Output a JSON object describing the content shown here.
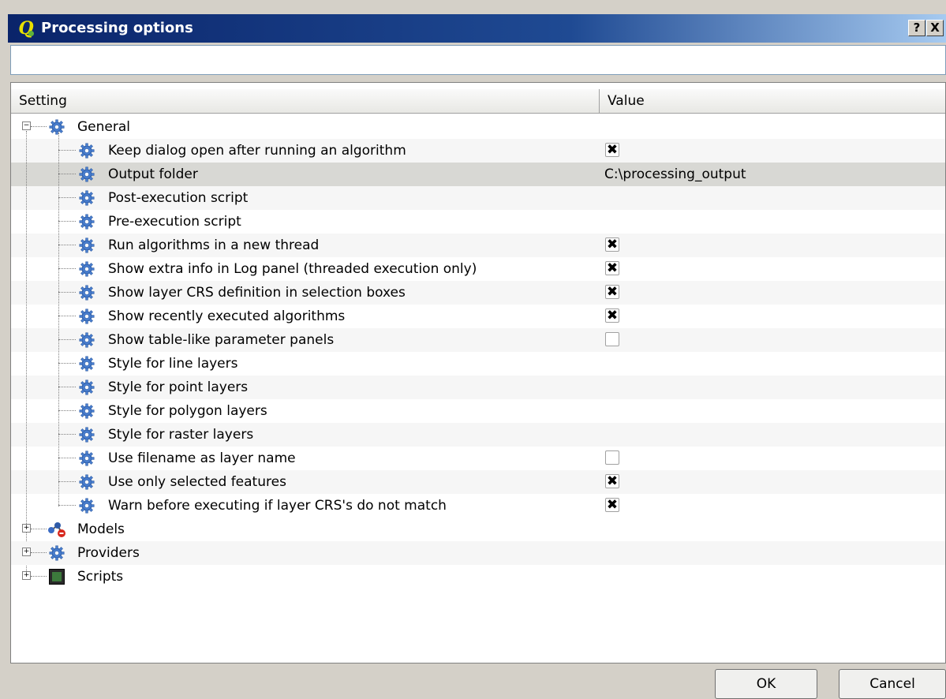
{
  "window": {
    "title": "Processing options",
    "help_btn": "?",
    "close_btn": "X"
  },
  "search": {
    "value": "",
    "placeholder": ""
  },
  "table": {
    "headers": {
      "setting": "Setting",
      "value": "Value"
    },
    "general": {
      "label": "General",
      "items": [
        {
          "label": "Keep dialog open after running an algorithm",
          "type": "checkbox",
          "checked": true,
          "mark": "✖"
        },
        {
          "label": "Output folder",
          "type": "text",
          "value": "C:\\processing_output",
          "selected": true
        },
        {
          "label": "Post-execution script",
          "type": "text",
          "value": ""
        },
        {
          "label": "Pre-execution script",
          "type": "text",
          "value": ""
        },
        {
          "label": "Run algorithms in a new thread",
          "type": "checkbox",
          "checked": true,
          "mark": "✖"
        },
        {
          "label": "Show extra info in Log panel (threaded execution only)",
          "type": "checkbox",
          "checked": true,
          "mark": "✖"
        },
        {
          "label": "Show layer CRS definition in selection boxes",
          "type": "checkbox",
          "checked": true,
          "mark": "✖"
        },
        {
          "label": "Show recently executed algorithms",
          "type": "checkbox",
          "checked": true,
          "mark": "✖"
        },
        {
          "label": "Show table-like parameter panels",
          "type": "checkbox",
          "checked": false,
          "mark": ""
        },
        {
          "label": "Style for line layers",
          "type": "text",
          "value": ""
        },
        {
          "label": "Style for point layers",
          "type": "text",
          "value": ""
        },
        {
          "label": "Style for polygon layers",
          "type": "text",
          "value": ""
        },
        {
          "label": "Style for raster layers",
          "type": "text",
          "value": ""
        },
        {
          "label": "Use filename as layer name",
          "type": "checkbox",
          "checked": false,
          "mark": ""
        },
        {
          "label": "Use only selected features",
          "type": "checkbox",
          "checked": true,
          "mark": "✖"
        },
        {
          "label": "Warn before executing if layer CRS's do not match",
          "type": "checkbox",
          "checked": true,
          "mark": "✖"
        }
      ]
    },
    "groups": [
      {
        "label": "Models",
        "icon": "models-icon"
      },
      {
        "label": "Providers",
        "icon": "gear-icon"
      },
      {
        "label": "Scripts",
        "icon": "terminal-icon"
      }
    ]
  },
  "buttons": {
    "ok": "OK",
    "cancel": "Cancel"
  },
  "colors": {
    "title_bar": "#0a246a",
    "selected_row": "#d8d8d4",
    "gear": "#4a7fd0"
  }
}
